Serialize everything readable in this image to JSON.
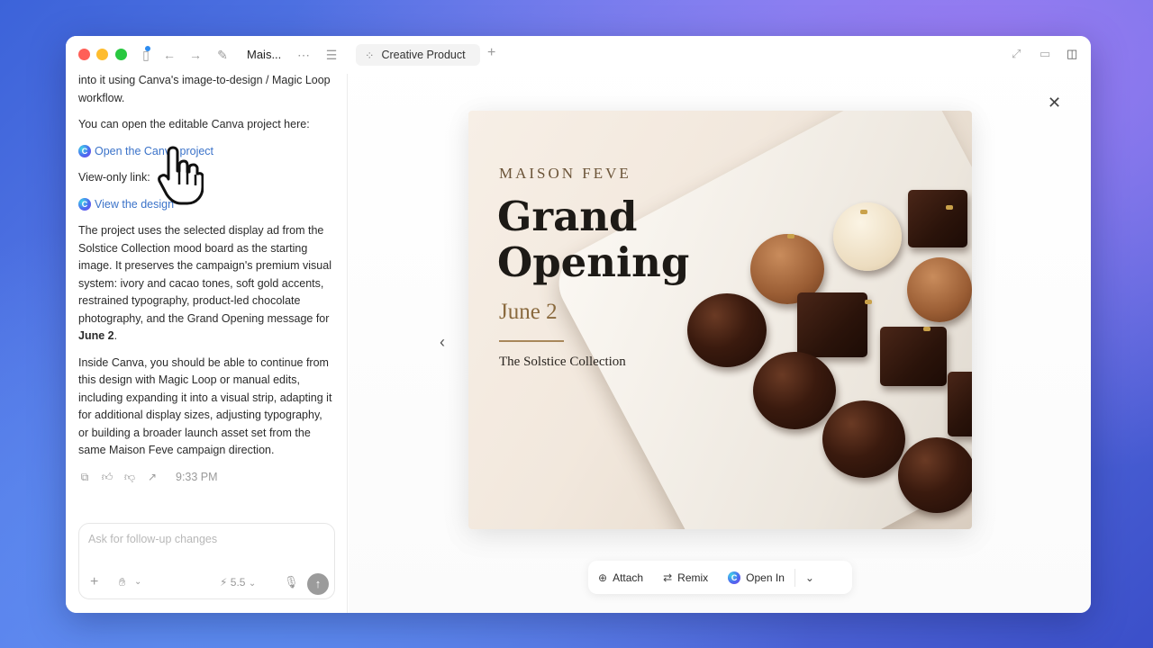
{
  "titlebar": {
    "title": "Mais..."
  },
  "chat": {
    "intro_text": "into it using Canva's image-to-design / Magic Loop workflow.",
    "open_prompt": "You can open the editable Canva project here:",
    "open_link": "Open the Canva project",
    "view_label": "View-only link:",
    "view_link": "View the design",
    "para1_pre": "The project uses the selected display ad from the Solstice Collection mood board as the starting image. It preserves the campaign's premium visual system: ivory and cacao tones, soft gold accents, restrained typography, product-led chocolate photography, and the Grand Opening message for ",
    "para1_bold": "June 2",
    "para1_post": ".",
    "para2": "Inside Canva, you should be able to continue from this design with Magic Loop or manual edits, including expanding it into a visual strip, adapting it for additional display sizes, adjusting typography, or building a broader launch asset set from the same Maison Feve campaign direction.",
    "timestamp": "9:33 PM"
  },
  "composer": {
    "placeholder": "Ask for follow-up changes",
    "model": "5.5"
  },
  "tab": {
    "label": "Creative Product"
  },
  "poster": {
    "brand": "MAISON FEVE",
    "headline": "Grand Opening",
    "date": "June 2",
    "collection": "The Solstice Collection"
  },
  "bottom_bar": {
    "attach": "Attach",
    "remix": "Remix",
    "open_in": "Open In"
  },
  "colors": {
    "link": "#3b73c9",
    "accent_gold": "#8a6a3e",
    "traffic_red": "#ff5f57",
    "traffic_yellow": "#febc2e",
    "traffic_green": "#28c840"
  }
}
